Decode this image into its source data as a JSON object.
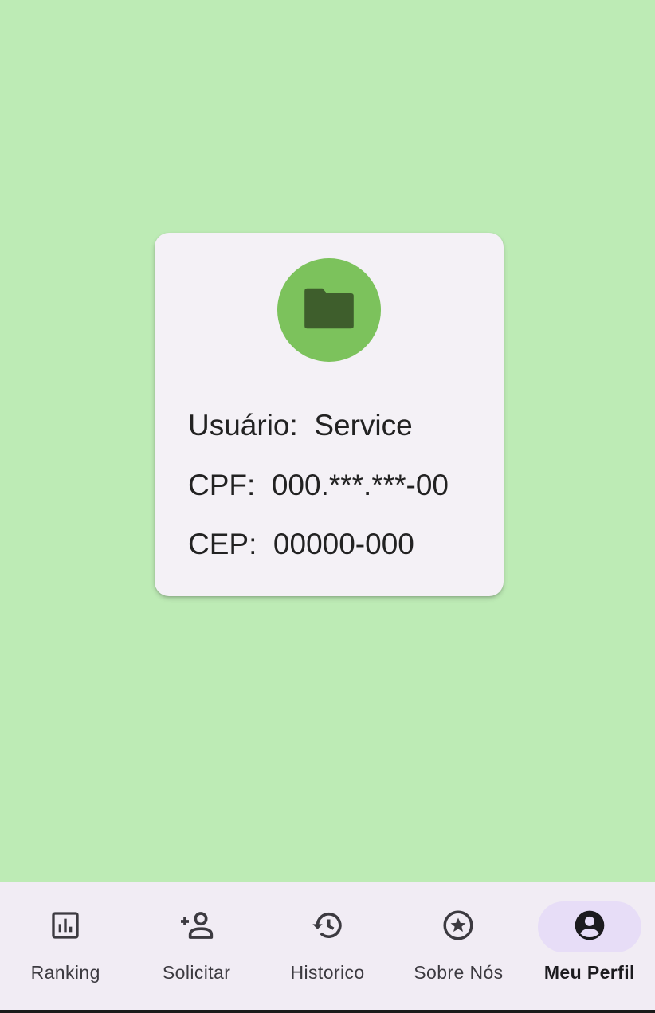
{
  "profile": {
    "avatar_icon": "folder-icon",
    "user_label": "Usuário:  Service",
    "cpf_label": "CPF:  000.***.***-00",
    "cep_label": "CEP:  00000-000"
  },
  "nav": {
    "items": [
      {
        "label": "Ranking",
        "icon": "bar-chart-icon",
        "active": false
      },
      {
        "label": "Solicitar",
        "icon": "person-add-icon",
        "active": false
      },
      {
        "label": "Historico",
        "icon": "history-icon",
        "active": false
      },
      {
        "label": "Sobre Nós",
        "icon": "star-circle-icon",
        "active": false
      },
      {
        "label": "Meu Perfil",
        "icon": "account-circle-icon",
        "active": true
      }
    ]
  },
  "colors": {
    "background": "#bdebb5",
    "card": "#f4f1f6",
    "avatar": "#7cc25c",
    "avatar_icon": "#3e5e2c",
    "nav_background": "#f1ecf4",
    "nav_active_pill": "#e7ddf7"
  }
}
